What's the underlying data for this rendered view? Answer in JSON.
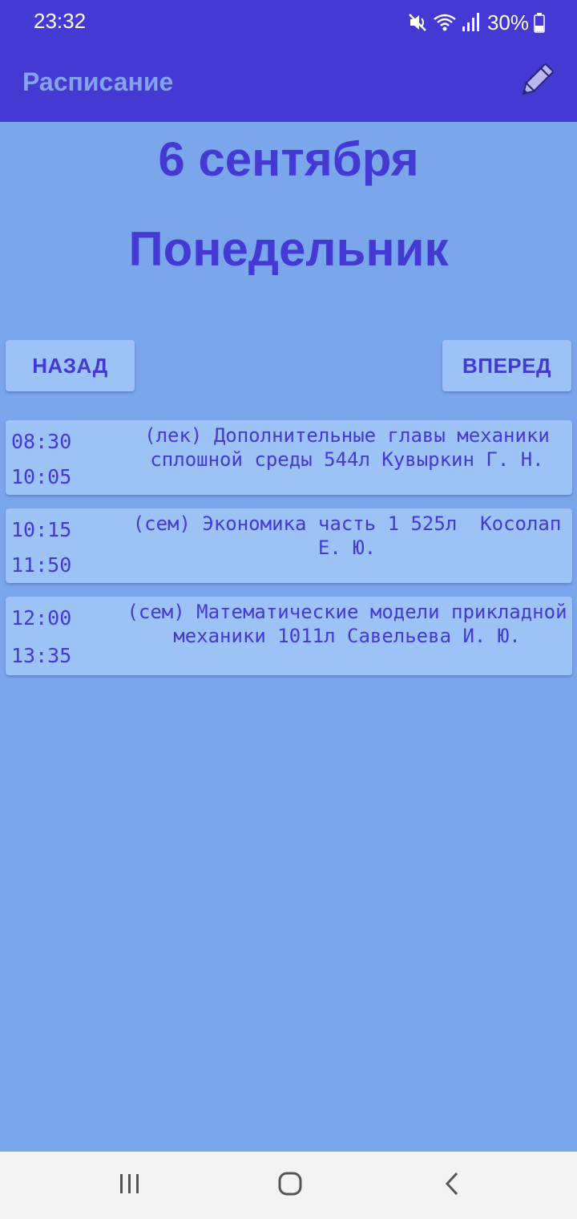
{
  "status_bar": {
    "time": "23:32",
    "battery": "30%",
    "icons": [
      "mute-icon",
      "wifi-icon",
      "signal-icon",
      "battery-icon"
    ]
  },
  "header": {
    "title": "Расписание",
    "edit_icon": "pencil-icon"
  },
  "day": {
    "date": "6 сентября",
    "weekday": "Понедельник"
  },
  "navigation": {
    "back_label": "НАЗАД",
    "forward_label": "ВПЕРЕД"
  },
  "lessons": [
    {
      "start": "08:30",
      "end": "10:05",
      "description": "(лек) Дополнительные главы механики сплошной среды 544л Кувыркин Г. Н."
    },
    {
      "start": "10:15",
      "end": "11:50",
      "description": "(сем) Экономика часть 1 525л  Косолап Е. Ю."
    },
    {
      "start": "12:00",
      "end": "13:35",
      "description": "(сем) Математические модели прикладной механики 1011л Савельева И. Ю."
    }
  ],
  "system_nav": {
    "recents_icon": "recents-icon",
    "home_icon": "home-icon",
    "back_icon": "back-icon"
  },
  "colors": {
    "header": "#4539d3",
    "background": "#7aa7ec",
    "card": "#9cc2f6",
    "accent_text": "#4539d3",
    "title_text": "#84a3ee"
  }
}
